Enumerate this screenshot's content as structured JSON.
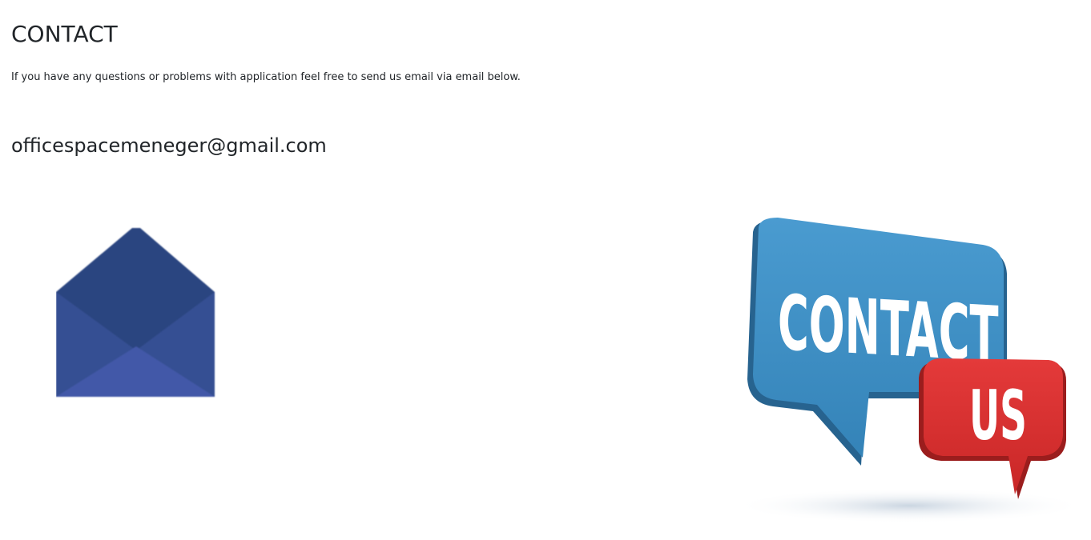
{
  "page": {
    "title": "CONTACT",
    "intro": "If you have any questions or problems with application feel free to send us email via email below.",
    "email": "officespacemeneger@gmail.com"
  },
  "graphic": {
    "line1": "CONTACT",
    "line2": "US",
    "blue": "#3f93c6",
    "red": "#d93030"
  },
  "icons": {
    "envelope": "envelope-icon",
    "colors": {
      "envelope_dark": "#2a4580",
      "envelope_mid": "#354f93",
      "envelope_light": "#4258a8"
    }
  }
}
